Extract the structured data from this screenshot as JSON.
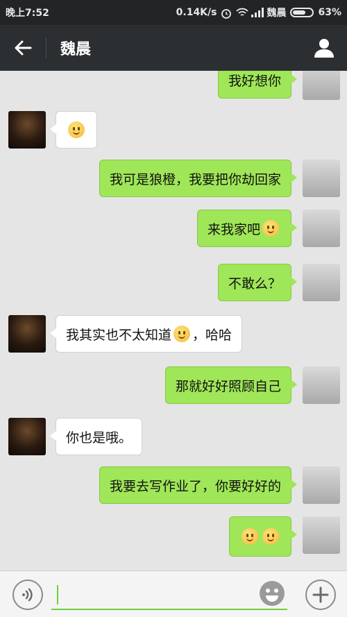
{
  "status_bar": {
    "time": "晚上7:52",
    "speed": "0.14K/s",
    "carrier": "魏晨",
    "battery": "63%"
  },
  "header": {
    "title": "魏晨"
  },
  "messages": [
    {
      "from": "self",
      "text": "我好想你"
    },
    {
      "from": "other",
      "text": ""
    },
    {
      "from": "self",
      "text": "我可是狼橙，我要把你劫回家"
    },
    {
      "from": "self",
      "text": "来我家吧"
    },
    {
      "from": "self",
      "text": "不敢么？"
    },
    {
      "from": "other",
      "text_a": "我其实也不太知道",
      "text_b": "，哈哈"
    },
    {
      "from": "self",
      "text": "那就好好照顾自己"
    },
    {
      "from": "other",
      "text": "你也是哦。"
    },
    {
      "from": "self",
      "text": "我要去写作业了，你要好好的"
    },
    {
      "from": "self",
      "text": ""
    }
  ],
  "input": {
    "value": ""
  },
  "colors": {
    "self_bubble": "#9fe658",
    "other_bubble": "#ffffff",
    "accent": "#6fcf3a"
  }
}
